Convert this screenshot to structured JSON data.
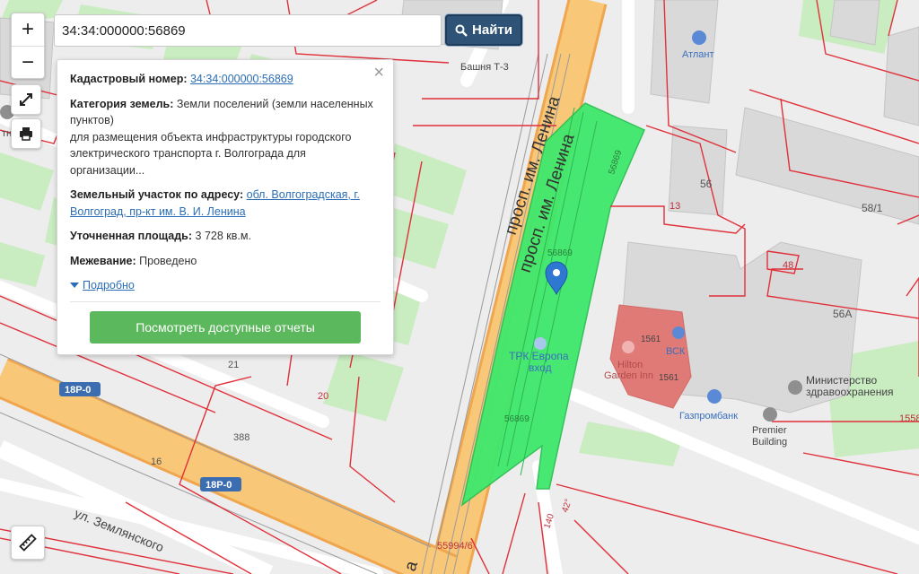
{
  "search": {
    "value": "34:34:000000:56869",
    "button_label": "Найти"
  },
  "controls": {
    "zoom_in": "+",
    "zoom_out": "−"
  },
  "popup": {
    "cadastral_label": "Кадастровый номер:",
    "cadastral_value": "34:34:000000:56869",
    "category_label": "Категория земель:",
    "category_value_1": "Земли поселений (земли населенных пунктов)",
    "category_value_2": "для размещения объекта инфраструктуры городского электрического транспорта г. Волгограда для организации...",
    "address_label": "Земельный участок по адресу:",
    "address_value": "обл. Волгоградская, г. Волгоград, пр-кт им. В. И. Ленина",
    "area_label": "Уточненная площадь:",
    "area_value": "3 728 кв.м.",
    "survey_label": "Межевание:",
    "survey_value": "Проведено",
    "more_link": "Подробно",
    "report_button": "Посмотреть доступные отчеты",
    "close": "×"
  },
  "map": {
    "street_main_1": "просп. им. Ленина",
    "street_main_2": "просп. им. Ленина",
    "street_main_3": "a",
    "street_zemlyanskogo": "ул. Землянского",
    "road_badge_1": "18Р-0",
    "road_badge_2": "18Р-0",
    "parcel_label_1": "56869",
    "parcel_label_2": "56869",
    "parcel_label_3": "56869",
    "label_55994": "55994/6",
    "num_56": "56",
    "num_581": "58/1",
    "num_13": "13",
    "num_48": "48",
    "num_56a": "56А",
    "num_1561a": "1561",
    "num_1561b": "1561",
    "num_1558": "1558",
    "num_42": "42°",
    "num_140": "140",
    "num_21": "21",
    "num_20": "20",
    "num_388": "388",
    "num_16": "16",
    "poi_bashnya": "Башня Т-3",
    "poi_atlant": "Атлант",
    "poi_trk_1": "ТРК Европа",
    "poi_trk_2": "вход",
    "poi_hilton_1": "Hilton",
    "poi_hilton_2": "Garden Inn",
    "poi_vsk": "ВСК",
    "poi_ministry_1": "Министерство",
    "poi_ministry_2": "здравоохранения",
    "poi_gazprom": "Газпромбанк",
    "poi_premier_1": "Premier",
    "poi_premier_2": "Building",
    "poi_tn": "тн"
  },
  "colors": {
    "parcel": "#3ee86a",
    "boundary": "#e0303a",
    "road_main": "#f6c36b",
    "road_casing": "#f2a84f",
    "building": "#d6d6d6",
    "hotel": "#e06c6c",
    "park": "#c8ecc0",
    "accent": "#2f5377",
    "report_button": "#5cb85c"
  },
  "icons": [
    "plus-icon",
    "minus-icon",
    "expand-icon",
    "print-icon",
    "ruler-icon",
    "search-icon",
    "close-icon",
    "map-pin-icon",
    "chevron-down-icon"
  ]
}
